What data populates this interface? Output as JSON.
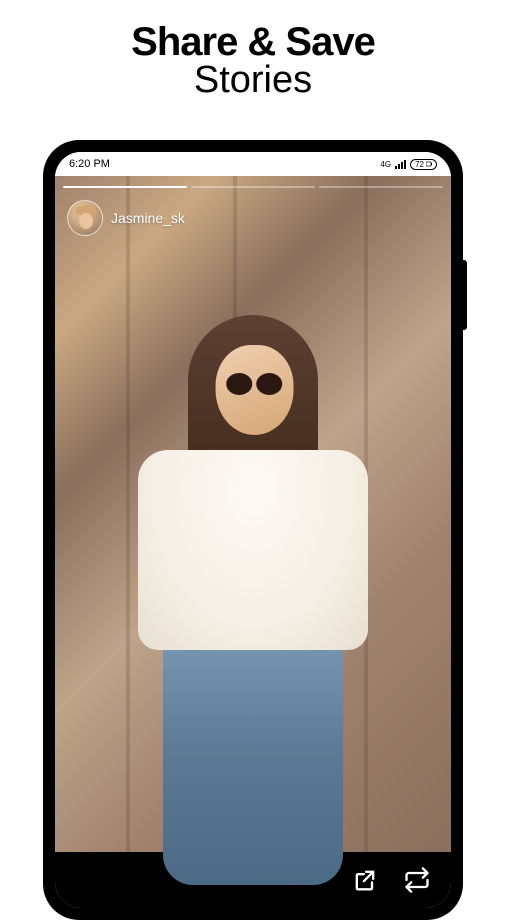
{
  "headline": {
    "bold": "Share & Save",
    "light": "Stories"
  },
  "status_bar": {
    "time": "6:20 PM",
    "network": "4G",
    "battery": "72"
  },
  "story": {
    "username": "Jasmine_sk",
    "progress_segments": 3,
    "active_segment": 0
  },
  "actions": {
    "share_icon": "share-icon",
    "repost_icon": "repost-icon"
  }
}
